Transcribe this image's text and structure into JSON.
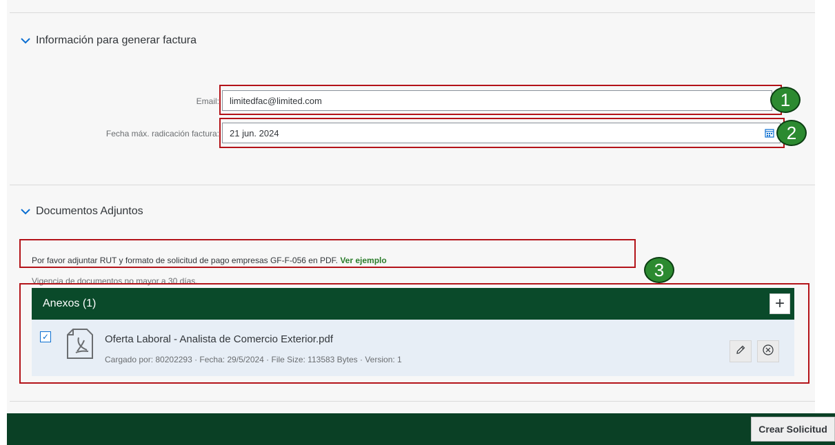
{
  "sections": {
    "invoice_info": {
      "title": "Información para generar factura"
    },
    "attachments_section": {
      "title": "Documentos Adjuntos"
    }
  },
  "form": {
    "email_label": "Email:",
    "email_value": "limitedfac@limited.com",
    "date_label": "Fecha máx. radicación factura:",
    "date_value": "21 jun. 2024"
  },
  "docs": {
    "instruction": "Por favor adjuntar RUT y formato de solicitud de pago empresas GF-F-056 en PDF.",
    "example_link": "Ver ejemplo",
    "validity": "Vigencia de documentos no mayor a 30 días."
  },
  "attachments": {
    "header": "Anexos (1)",
    "add_label": "+",
    "items": [
      {
        "name": "Oferta Laboral - Analista de Comercio Exterior.pdf",
        "meta": "Cargado por: 80202293 · Fecha: 29/5/2024 · File Size: 113583 Bytes · Version: 1",
        "checked": true
      }
    ]
  },
  "callouts": [
    "1",
    "2",
    "3"
  ],
  "footer": {
    "create_button": "Crear Solicitud"
  },
  "colors": {
    "brand_dark": "#0a4025",
    "callout_border": "#b31218",
    "badge_fill": "#2c8a30",
    "link": "#2b7d2b"
  },
  "icons": [
    "chevron-down-icon",
    "calendar-icon",
    "pdf-file-icon",
    "checkbox-icon",
    "add-icon",
    "edit-icon",
    "remove-icon"
  ]
}
